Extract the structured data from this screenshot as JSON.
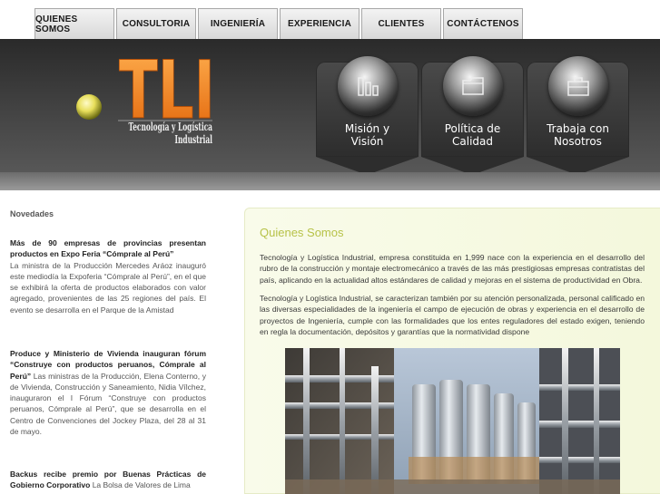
{
  "nav": {
    "items": [
      "QUIENES SOMOS",
      "CONSULTORIA",
      "INGENIERÍA",
      "EXPERIENCIA",
      "CLIENTES",
      "CONTÁCTENOS"
    ]
  },
  "logo": {
    "letters": "TLI",
    "tagline": "Tecnología y Logística Industrial"
  },
  "cards": [
    {
      "line1": "Misión y",
      "line2": "Visión",
      "icon": "bar-chart-icon"
    },
    {
      "line1": "Política de",
      "line2": "Calidad",
      "icon": "folder-icon"
    },
    {
      "line1": "Trabaja con",
      "line2": "Nosotros",
      "icon": "briefcase-icon"
    }
  ],
  "sidebar": {
    "title": "Novedades",
    "news": [
      {
        "headline": "Más de 90 empresas de provincias presentan productos en Expo Feria “Cómprale al Perú”",
        "body": "La ministra de la Producción Mercedes Aráoz inauguró este mediodía la Expoferia “Cómprale al Perú”, en el que se exhibirá la oferta de productos elaborados con valor agregado, provenientes de las 25 regiones del país. El evento se desarrolla en el Parque de la Amistad"
      },
      {
        "headline": "Produce y Ministerio de Vivienda inauguran fórum “Construye con productos peruanos, Cómprale al Perú”",
        "body": "Las ministras de la Producción, Elena Conterno, y de Vivienda, Construcción y Saneamiento, Nidia Vílchez, inauguraron el I Fórum “Construye con productos peruanos, Cómprale al Perú”, que se desarrolla en el Centro de Convenciones del Jockey Plaza, del 28 al 31 de mayo."
      },
      {
        "headline": "Backus recibe premio por Buenas Prácticas de Gobierno Corporativo",
        "body": "La Bolsa de Valores de Lima"
      }
    ]
  },
  "main": {
    "title": "Quienes Somos",
    "para1": "Tecnología y Logística Industrial, empresa constituida en 1,999 nace con la experiencia en el desarrollo del rubro de la construcción y montaje electromecánico a través de las más prestigiosas empresas contratistas del país, aplicando en la actualidad altos estándares de calidad y mejoras en el sistema de productividad en Obra.",
    "para2": "Tecnología y Logística Industrial, se caracterizan también por su atención personalizada, personal calificado en las diversas especialidades de la ingeniería el campo de ejecución de obras y experiencia en el desarrollo de proyectos de Ingeniería, cumple con las formalidades que los entes reguladores del estado exigen, teniendo en regla la documentación, depósitos y garantías que la normatividad dispone"
  },
  "colors": {
    "accent_orange": "#f0861a",
    "title_green": "#b7c248"
  }
}
